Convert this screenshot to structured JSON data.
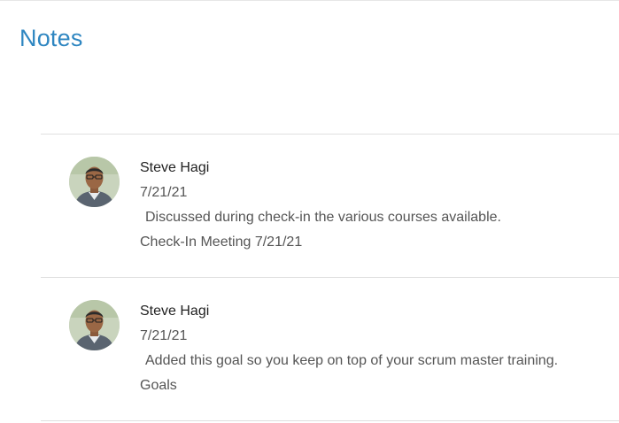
{
  "section": {
    "title": "Notes"
  },
  "notes": [
    {
      "author": "Steve Hagi",
      "date": "7/21/21",
      "body": "Discussed during check-in the various courses available.",
      "source": "Check-In Meeting 7/21/21"
    },
    {
      "author": "Steve Hagi",
      "date": "7/21/21",
      "body": "Added this goal so you keep on top of your scrum master training.",
      "source": "Goals"
    }
  ],
  "colors": {
    "title": "#2e86c1",
    "text": "#555555",
    "author": "#222222",
    "divider": "#dfdfdf"
  },
  "icons": {
    "avatar": "user-avatar-photo"
  }
}
